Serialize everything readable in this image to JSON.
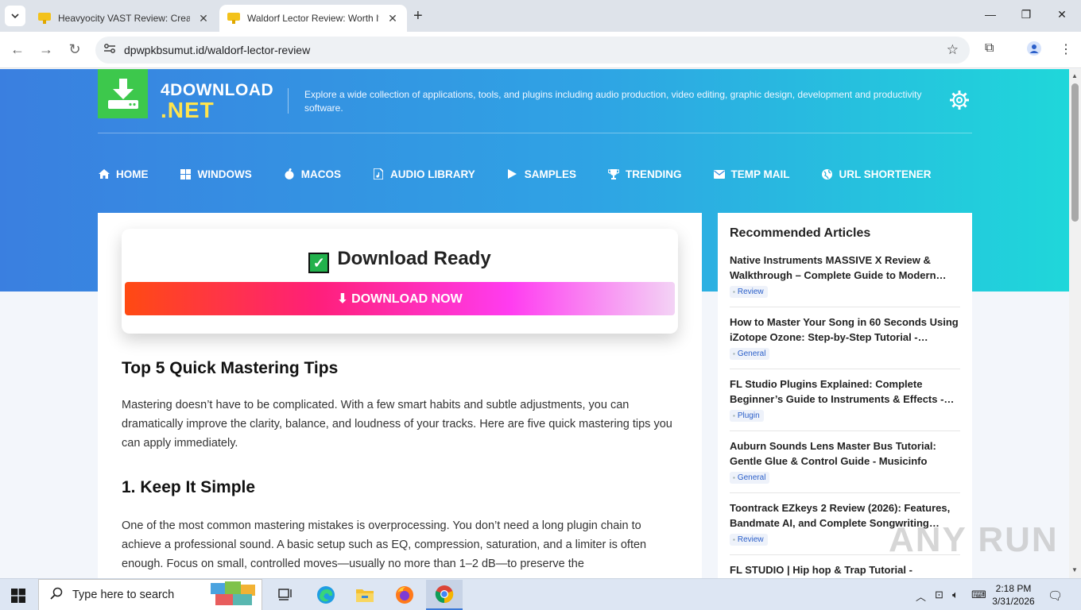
{
  "browser": {
    "tabs": [
      {
        "title": "Heavyocity VAST Review: Creati",
        "active": false
      },
      {
        "title": "Waldorf Lector Review: Worth It",
        "active": true
      }
    ],
    "url": "dpwpkbsumut.id/waldorf-lector-review"
  },
  "site": {
    "logo_line1": "4DOWNLOAD",
    "logo_line2": ".NET",
    "tagline": "Explore a wide collection of applications, tools, and plugins including audio production, video editing, graphic design, development and productivity software.",
    "nav": [
      {
        "label": "HOME",
        "icon": "home-icon"
      },
      {
        "label": "WINDOWS",
        "icon": "windows-icon"
      },
      {
        "label": "MACOS",
        "icon": "apple-icon"
      },
      {
        "label": "AUDIO LIBRARY",
        "icon": "audio-file-icon"
      },
      {
        "label": "SAMPLES",
        "icon": "play-icon"
      },
      {
        "label": "TRENDING",
        "icon": "trophy-icon"
      },
      {
        "label": "TEMP MAIL",
        "icon": "mail-icon"
      },
      {
        "label": "URL SHORTENER",
        "icon": "globe-icon"
      }
    ]
  },
  "download": {
    "title": "Download Ready",
    "button": "⬇ DOWNLOAD NOW"
  },
  "article": {
    "heading1": "Top 5 Quick Mastering Tips",
    "intro": "Mastering doesn’t have to be complicated. With a few smart habits and subtle adjustments, you can dramatically improve the clarity, balance, and loudness of your tracks. Here are five quick mastering tips you can apply immediately.",
    "heading2": "1. Keep It Simple",
    "para2": "One of the most common mastering mistakes is overprocessing. You don’t need a long plugin chain to achieve a professional sound. A basic setup such as EQ, compression, saturation, and a limiter is often enough. Focus on small, controlled moves—usually no more than 1–2 dB—to preserve the"
  },
  "sidebar": {
    "title": "Recommended Articles",
    "items": [
      {
        "title": "Native Instruments MASSIVE X Review & Walkthrough – Complete Guide to Modern…",
        "tag": "Review"
      },
      {
        "title": "How to Master Your Song in 60 Seconds Using iZotope Ozone: Step-by-Step Tutorial -…",
        "tag": "General"
      },
      {
        "title": "FL Studio Plugins Explained: Complete Beginner’s Guide to Instruments & Effects -…",
        "tag": "Plugin"
      },
      {
        "title": "Auburn Sounds Lens Master Bus Tutorial: Gentle Glue & Control Guide - Musicinfo",
        "tag": "General"
      },
      {
        "title": "Toontrack EZkeys 2 Review (2026): Features, Bandmate AI, and Complete Songwriting…",
        "tag": "Review"
      },
      {
        "title": "FL STUDIO | Hip hop & Trap Tutorial -",
        "tag": ""
      }
    ]
  },
  "taskbar": {
    "search_placeholder": "Type here to search",
    "time": "2:18 PM",
    "date": "3/31/2026"
  },
  "watermark": "ANY RUN",
  "colors": {
    "hero_start": "#3a7fe0",
    "hero_end": "#1fd7da",
    "logo_green": "#3dc84c",
    "logo_yellow": "#ffe44d"
  }
}
